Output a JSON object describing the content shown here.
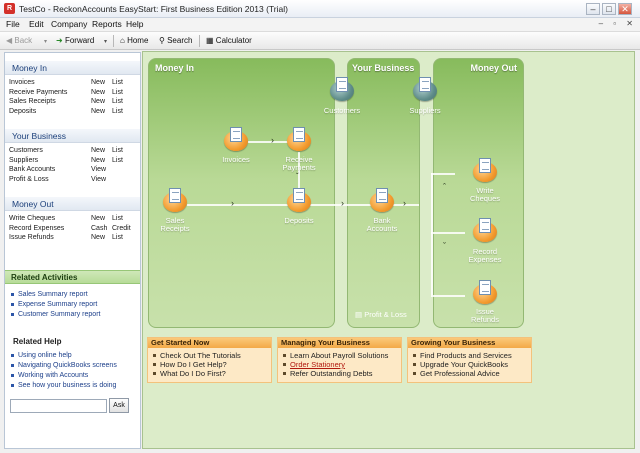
{
  "window": {
    "title": "TestCo - ReckonAccounts EasyStart: First Business Edition 2013 (Trial)",
    "controls": [
      "–",
      "□",
      "✕"
    ]
  },
  "menu": [
    "File",
    "Edit",
    "Company",
    "Reports",
    "Help"
  ],
  "toolbar": {
    "back": "Back",
    "forward": "Forward",
    "home": "Home",
    "search": "Search",
    "calculator": "Calculator"
  },
  "nav": {
    "money_in": {
      "title": "Money In",
      "rows": [
        {
          "label": "Invoices",
          "a1": "New",
          "a2": "List"
        },
        {
          "label": "Receive Payments",
          "a1": "New",
          "a2": "List"
        },
        {
          "label": "Sales Receipts",
          "a1": "New",
          "a2": "List"
        },
        {
          "label": "Deposits",
          "a1": "New",
          "a2": "List"
        }
      ]
    },
    "your_business": {
      "title": "Your Business",
      "rows": [
        {
          "label": "Customers",
          "a1": "New",
          "a2": "List"
        },
        {
          "label": "Suppliers",
          "a1": "New",
          "a2": "List"
        },
        {
          "label": "Bank Accounts",
          "a1": "View",
          "a2": ""
        },
        {
          "label": "Profit & Loss",
          "a1": "View",
          "a2": ""
        }
      ]
    },
    "money_out": {
      "title": "Money Out",
      "rows": [
        {
          "label": "Write Cheques",
          "a1": "New",
          "a2": "List"
        },
        {
          "label": "Record Expenses",
          "a1": "Cash",
          "a2": "Credit"
        },
        {
          "label": "Issue Refunds",
          "a1": "New",
          "a2": "List"
        }
      ]
    }
  },
  "related_activities": {
    "title": "Related Activities",
    "items": [
      "Sales Summary report",
      "Expense Summary report",
      "Customer Summary report"
    ]
  },
  "related_help": {
    "title": "Related Help",
    "items": [
      "Using online help",
      "Navigating QuickBooks screens",
      "Working with Accounts",
      "See how your business is doing"
    ],
    "ask_label": "Ask"
  },
  "workflow": {
    "panels": {
      "money_in": "Money In",
      "your_business": "Your Business",
      "money_out": "Money Out"
    },
    "nodes": {
      "invoices": "Invoices",
      "receive_payments_1": "Receive",
      "receive_payments_2": "Payments",
      "sales_receipts_1": "Sales",
      "sales_receipts_2": "Receipts",
      "deposits": "Deposits",
      "customers": "Customers",
      "suppliers": "Suppliers",
      "bank_accounts_1": "Bank",
      "bank_accounts_2": "Accounts",
      "write_cheques_1": "Write",
      "write_cheques_2": "Cheques",
      "record_expenses_1": "Record",
      "record_expenses_2": "Expenses",
      "issue_refunds_1": "Issue",
      "issue_refunds_2": "Refunds",
      "profit_loss": "Profit & Loss"
    }
  },
  "boxes": {
    "get_started": {
      "title": "Get Started Now",
      "items": [
        "Check Out The Tutorials",
        "How Do I Get Help?",
        "What Do I Do First?"
      ]
    },
    "managing": {
      "title": "Managing Your Business",
      "items": [
        "Learn About Payroll Solutions",
        "Order Stationery",
        "Refer Outstanding Debts"
      ]
    },
    "growing": {
      "title": "Growing Your Business",
      "items": [
        "Find Products and Services",
        "Upgrade Your QuickBooks",
        "Get Professional Advice"
      ]
    }
  }
}
